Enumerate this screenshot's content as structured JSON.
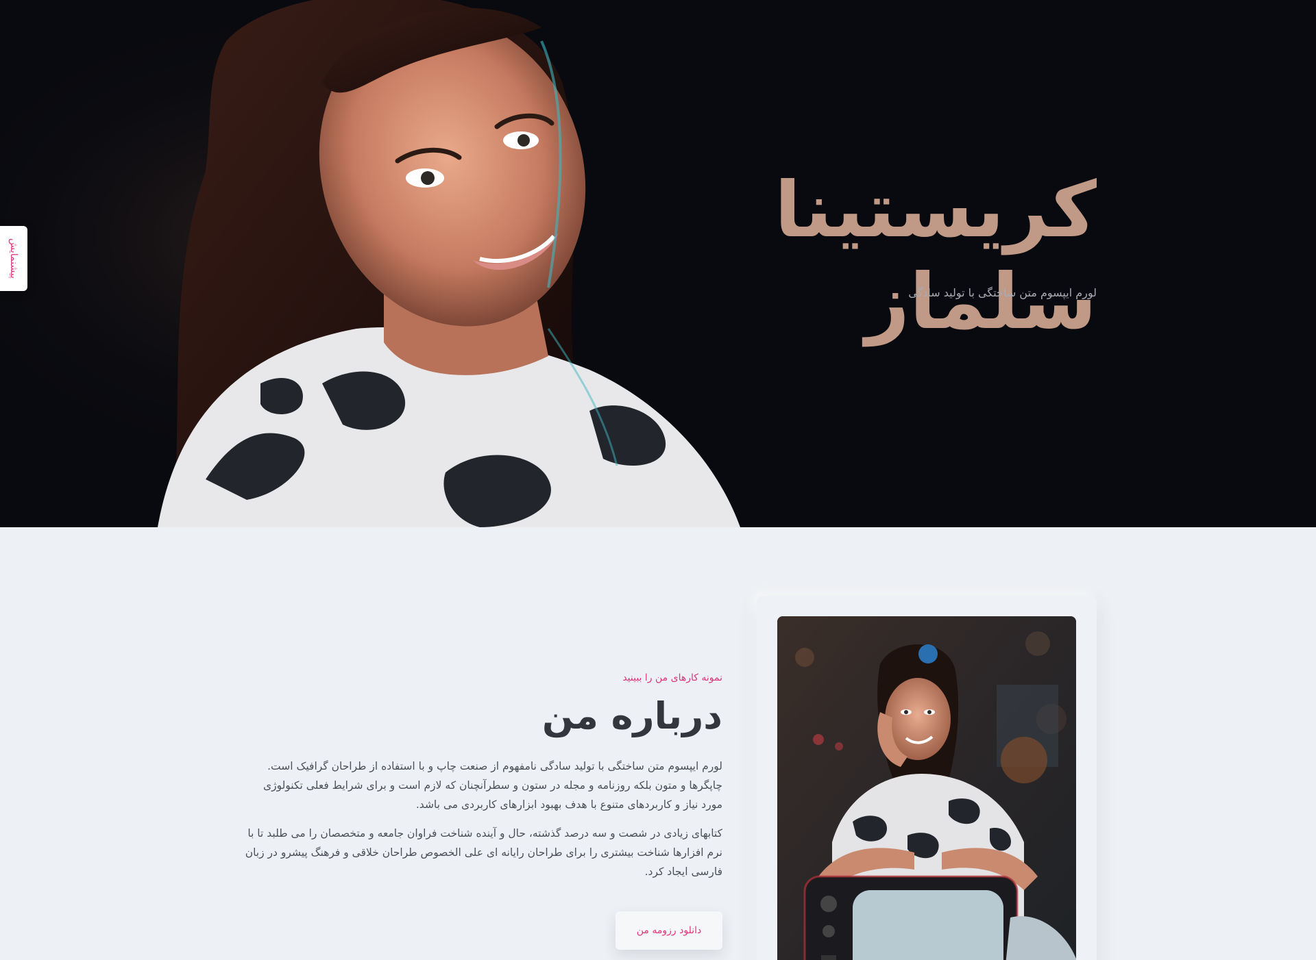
{
  "hero": {
    "title": "کریستینا سلماز",
    "subtitle": "لورم ایپسوم متن ساختگی با تولید سادگی"
  },
  "side_tab": {
    "label": "پیشنمایش"
  },
  "about": {
    "eyebrow": "نمونه کارهای من را ببینید",
    "title": "درباره من",
    "paragraphs": [
      "لورم ایپسوم متن ساختگی با تولید سادگی نامفهوم از صنعت چاپ و با استفاده از طراحان گرافیک است. چاپگرها و متون بلکه روزنامه و مجله در ستون و سطرآنچنان که لازم است و برای شرایط فعلی تکنولوژی مورد نیاز و کاربردهای متنوع با هدف بهبود ابزارهای کاربردی می باشد.",
      "کتابهای زیادی در شصت و سه درصد گذشته، حال و آینده شناخت فراوان جامعه و متخصصان را می طلبد تا با نرم افزارها شناخت بیشتری را برای طراحان رایانه ای علی الخصوص طراحان خلاقی و فرهنگ پیشرو در زبان فارسی ایجاد کرد."
    ],
    "button_label": "دانلود رزومه من"
  },
  "colors": {
    "accent": "#e0357a",
    "hero_title": "#c19a87",
    "hero_bg": "#090a0f",
    "section_bg": "#edf0f4"
  }
}
